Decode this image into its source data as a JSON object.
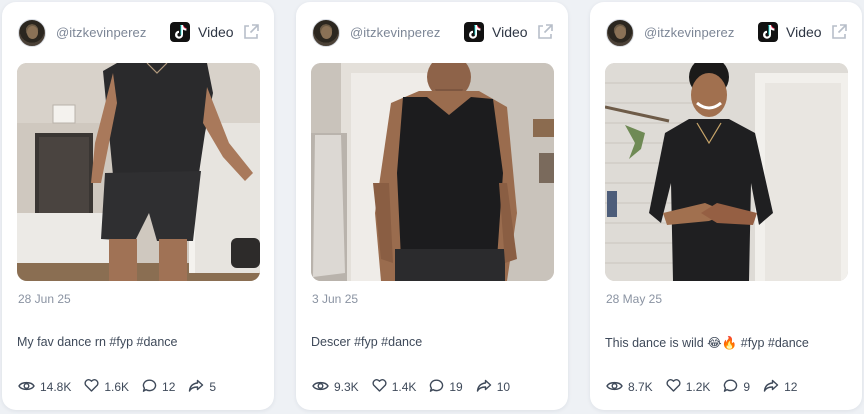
{
  "posts": [
    {
      "handle": "@itzkevinperez",
      "platform_icon": "tiktok-icon",
      "type": "Video",
      "date": "28 Jun 25",
      "caption": "My fav dance rn #fyp #dance",
      "views": "14.8K",
      "likes": "1.6K",
      "comments": "12",
      "shares": "5"
    },
    {
      "handle": "@itzkevinperez",
      "platform_icon": "tiktok-icon",
      "type": "Video",
      "date": "3 Jun 25",
      "caption": "Descer #fyp #dance",
      "views": "9.3K",
      "likes": "1.4K",
      "comments": "19",
      "shares": "10"
    },
    {
      "handle": "@itzkevinperez",
      "platform_icon": "tiktok-icon",
      "type": "Video",
      "date": "28 May 25",
      "caption": "This dance is wild 😂🔥 #fyp #dance",
      "views": "8.7K",
      "likes": "1.2K",
      "comments": "9",
      "shares": "12"
    }
  ],
  "colors": {
    "card_bg": "#ffffff",
    "page_bg": "#eef1f5",
    "muted_text": "#8a93a2",
    "body_text": "#3f4a5a"
  }
}
